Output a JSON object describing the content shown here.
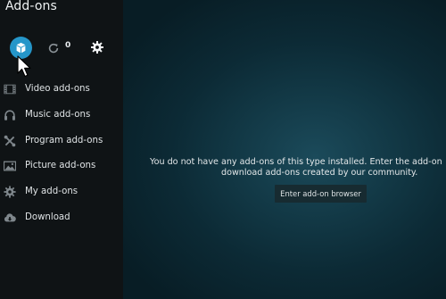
{
  "header": {
    "title": "Add-ons"
  },
  "actions": {
    "update_count": "0",
    "install_icon": "addon-box-icon",
    "update_icon": "refresh-icon",
    "settings_icon": "gear-icon"
  },
  "menu": {
    "items": [
      {
        "label": "Video add-ons",
        "icon": "film-icon"
      },
      {
        "label": "Music add-ons",
        "icon": "headphones-icon"
      },
      {
        "label": "Program add-ons",
        "icon": "tools-icon"
      },
      {
        "label": "Picture add-ons",
        "icon": "picture-icon"
      },
      {
        "label": "My add-ons",
        "icon": "gear-icon"
      },
      {
        "label": "Download",
        "icon": "cloud-download-icon"
      }
    ]
  },
  "main": {
    "message_line1": "You do not have any add-ons of this type installed. Enter the add-on",
    "message_line2": "download add-ons created by our community.",
    "button_label": "Enter add-on browser"
  },
  "colors": {
    "accent": "#2596c9",
    "sidebar_bg": "#0f1315",
    "main_bg": "#0c2a35"
  }
}
